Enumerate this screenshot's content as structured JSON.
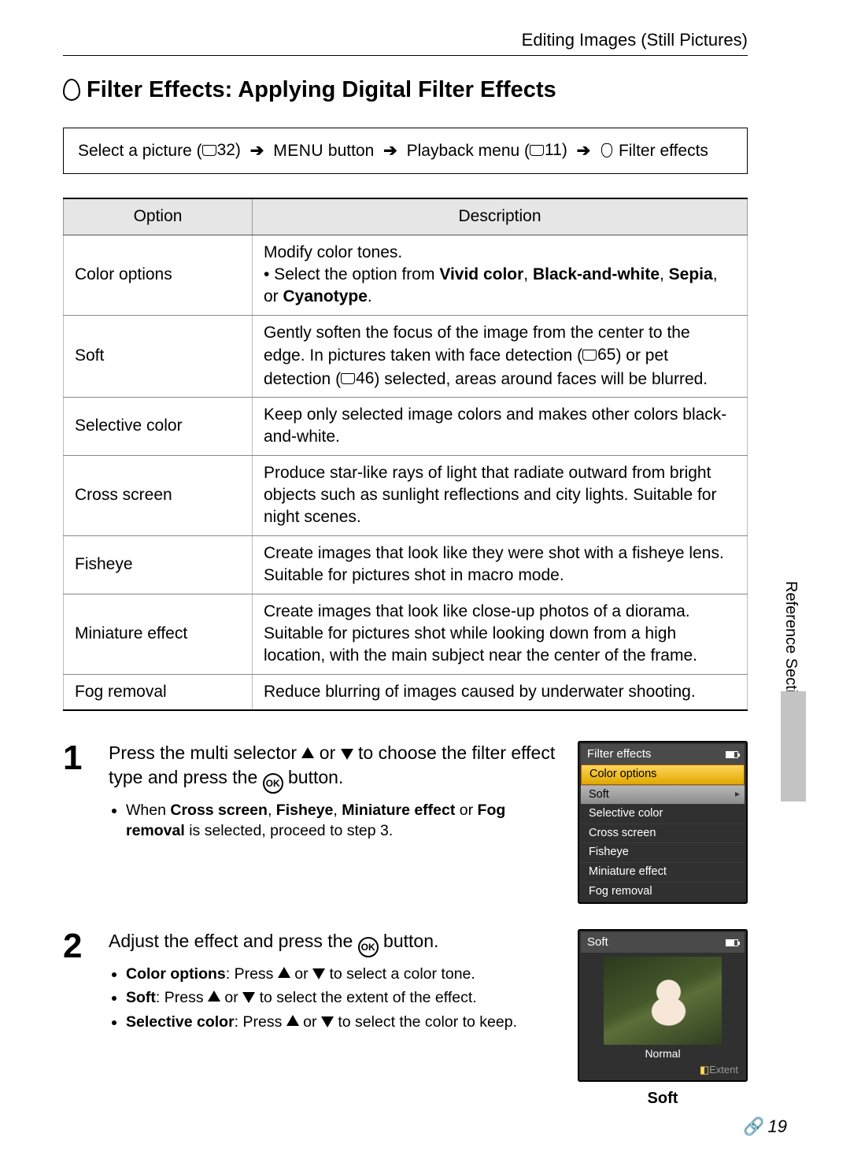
{
  "header": {
    "section": "Editing Images (Still Pictures)"
  },
  "title": "Filter Effects: Applying Digital Filter Effects",
  "nav": {
    "select_picture": "Select a picture (",
    "ref1": "32)",
    "menu_button": "MENU",
    "button_word": " button",
    "playback": "Playback menu (",
    "ref2": "11)",
    "filter_effects": " Filter effects"
  },
  "table": {
    "head": {
      "option": "Option",
      "description": "Description"
    },
    "rows": [
      {
        "option": "Color options",
        "desc_intro": "Modify color tones.",
        "desc_bullet_pre": "• Select the option from ",
        "opt1": "Vivid color",
        "c1": ", ",
        "opt2": "Black-and-white",
        "c2": ", ",
        "opt3": "Sepia",
        "c3": ", or ",
        "opt4": "Cyanotype",
        "period": "."
      },
      {
        "option": "Soft",
        "desc_a": "Gently soften the focus of the image from the center to the edge. In pictures taken with face detection (",
        "ref_a": "65",
        "desc_b": ") or pet detection (",
        "ref_b": "46",
        "desc_c": ") selected, areas around faces will be blurred."
      },
      {
        "option": "Selective color",
        "description": "Keep only selected image colors and makes other colors black-and-white."
      },
      {
        "option": "Cross screen",
        "description": "Produce star-like rays of light that radiate outward from bright objects such as sunlight reflections and city lights. Suitable for night scenes."
      },
      {
        "option": "Fisheye",
        "description": "Create images that look like they were shot with a fisheye lens. Suitable for pictures shot in macro mode."
      },
      {
        "option": "Miniature effect",
        "description": "Create images that look like close-up photos of a diorama. Suitable for pictures shot while looking down from a high location, with the main subject near the center of the frame."
      },
      {
        "option": "Fog removal",
        "description": "Reduce blurring of images caused by underwater shooting."
      }
    ]
  },
  "steps": {
    "s1": {
      "num": "1",
      "line_a": "Press the multi selector ",
      "or": " or ",
      "line_b": " to choose the filter effect type and press the ",
      "ok": "OK",
      "line_c": " button.",
      "sub_pre": "When ",
      "k1": "Cross screen",
      "cc1": ", ",
      "k2": "Fisheye",
      "cc2": ", ",
      "k3": "Miniature effect",
      "cc3": " or ",
      "k4": "Fog removal",
      "sub_post": " is selected, proceed to step 3."
    },
    "s2": {
      "num": "2",
      "line_a": "Adjust the effect and press the ",
      "ok": "OK",
      "line_b": " button.",
      "li1_k": "Color options",
      "li1_a": ": Press ",
      "li1_b": " or ",
      "li1_c": " to select a color tone.",
      "li2_k": "Soft",
      "li2_a": ": Press ",
      "li2_b": " or ",
      "li2_c": " to select the extent of the effect.",
      "li3_k": "Selective color",
      "li3_a": ": Press ",
      "li3_b": " or ",
      "li3_c": " to select the color to keep."
    }
  },
  "screen1": {
    "title": "Filter effects",
    "items": [
      "Color options",
      "Soft",
      "Selective color",
      "Cross screen",
      "Fisheye",
      "Miniature effect",
      "Fog removal"
    ],
    "selected_index": 0,
    "highlight_index": 1
  },
  "screen2": {
    "title": "Soft",
    "label": "Normal",
    "extent": "Extent",
    "caption": "Soft"
  },
  "side": {
    "label": "Reference Section"
  },
  "page_number": "19"
}
